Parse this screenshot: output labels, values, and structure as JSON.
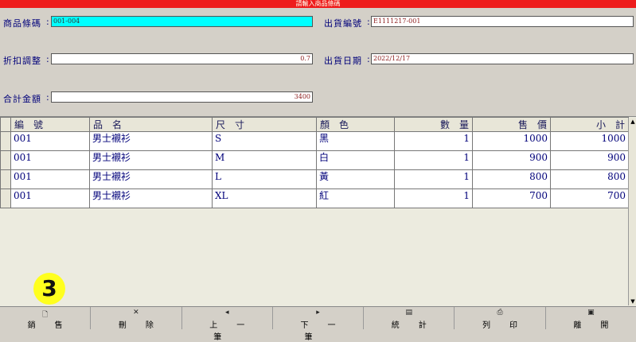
{
  "banner": "請輸入商品條碼",
  "form": {
    "barcode_label": "商品條碼",
    "barcode_value": "001-004",
    "discount_label": "折扣調整",
    "discount_value": "0.7",
    "total_label": "合計金額",
    "total_value": "3400",
    "order_no_label": "出貨編號",
    "order_no_value": "E1111217-001",
    "ship_date_label": "出貨日期",
    "ship_date_value": "2022/12/17"
  },
  "grid": {
    "headers": [
      "編　號",
      "品　名",
      "尺　寸",
      "顏　色",
      "數　量",
      "售　價",
      "小　計"
    ],
    "rows": [
      [
        "001",
        "男士襯衫",
        "S",
        "黑",
        "1",
        "1000",
        "1000"
      ],
      [
        "001",
        "男士襯衫",
        "M",
        "白",
        "1",
        "900",
        "900"
      ],
      [
        "001",
        "男士襯衫",
        "L",
        "黃",
        "1",
        "800",
        "800"
      ],
      [
        "001",
        "男士襯衫",
        "XL",
        "紅",
        "1",
        "700",
        "700"
      ]
    ]
  },
  "badge": "3",
  "toolbar": [
    {
      "label": "銷售",
      "icon": "document-icon",
      "glyph": "🗋"
    },
    {
      "label": "刪除",
      "icon": "delete-x-icon",
      "glyph": "✕"
    },
    {
      "label": "上一筆",
      "icon": "arrow-left-icon",
      "glyph": "◂"
    },
    {
      "label": "下一筆",
      "icon": "arrow-right-icon",
      "glyph": "▸"
    },
    {
      "label": "統計",
      "icon": "chart-icon",
      "glyph": "▤"
    },
    {
      "label": "列印",
      "icon": "printer-icon",
      "glyph": "⎙"
    },
    {
      "label": "離開",
      "icon": "save-icon",
      "glyph": "▣"
    }
  ]
}
